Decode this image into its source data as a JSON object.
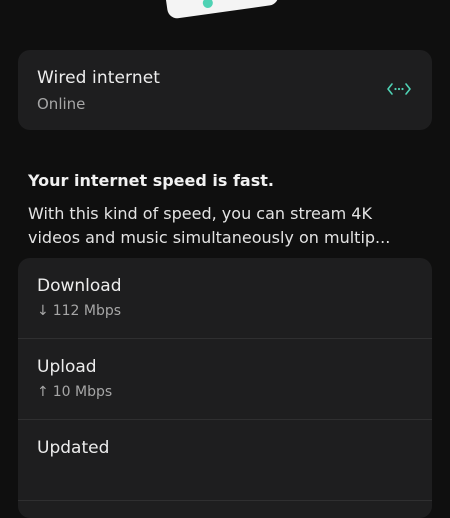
{
  "connection": {
    "title": "Wired internet",
    "status": "Online",
    "icon": "ethernet-icon",
    "accent_color": "#4fd2b4"
  },
  "speed": {
    "headline": "Your internet speed is fast.",
    "description": "With this kind of speed, you can stream 4K videos and music simultaneously on multip..."
  },
  "stats": {
    "download_label": "Download",
    "download_arrow": "↓",
    "download_value": "112 Mbps",
    "upload_label": "Upload",
    "upload_arrow": "↑",
    "upload_value": "10 Mbps",
    "updated_label": "Updated"
  }
}
